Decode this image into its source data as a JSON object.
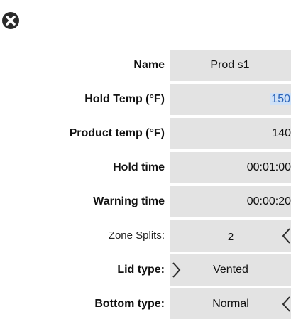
{
  "dialog": {
    "close_icon": "close-circle-icon"
  },
  "form": {
    "name": {
      "label": "Name",
      "value": "Prod s1"
    },
    "hold_temp": {
      "label": "Hold Temp (°F)",
      "value": "150"
    },
    "product_temp": {
      "label": "Product temp (°F)",
      "value": "140"
    },
    "hold_time": {
      "label": "Hold time",
      "value": "00:01:00"
    },
    "warning_time": {
      "label": "Warning time",
      "value": "00:00:20"
    },
    "zone_splits": {
      "label": "Zone Splits:",
      "value": "2",
      "arrow_icon": "chevron-left-icon"
    },
    "lid_type": {
      "label": "Lid type:",
      "value": "Vented",
      "arrow_icon": "chevron-right-icon"
    },
    "bottom_type": {
      "label": "Bottom type:",
      "value": "Normal",
      "arrow_icon": "chevron-left-icon"
    }
  },
  "colors": {
    "field_bg": "#e3e3e3",
    "selection_bg": "#cfe1f7",
    "selection_text": "#2a63b8",
    "icon": "#2b2b2b"
  }
}
